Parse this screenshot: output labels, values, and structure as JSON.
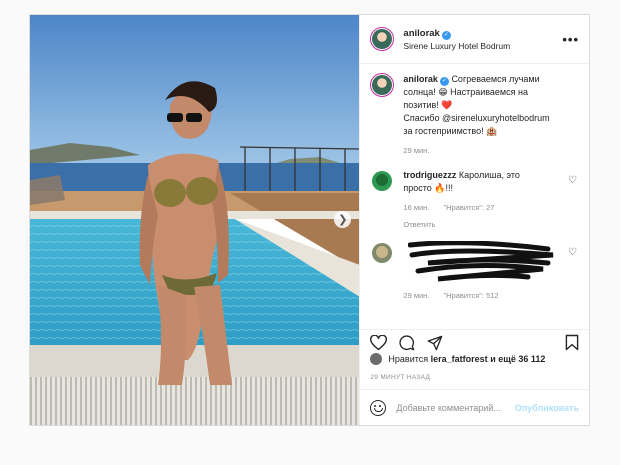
{
  "post": {
    "username": "anilorak",
    "location": "Sirene Luxury Hotel Bodrum",
    "more_label": "•••",
    "caption": {
      "line1": "Согреваемся лучами",
      "line2": "солнца! 😁 Настраиваемся на",
      "line3": "позитив! ❤️",
      "line4": "Спасибо @sireneluxuryhotelbodrum",
      "line5": "за гостеприимство! 🏨",
      "time": "29 мин."
    },
    "comments": [
      {
        "username": "trodriguezzz",
        "text": "Каролиша, это",
        "text2": "просто 🔥!!!",
        "time": "16 мин.",
        "likes": "\"Нравится\": 27",
        "replies": "Ответить"
      },
      {
        "username": "",
        "text": "",
        "time": "29 мин.",
        "likes": "\"Нравится\": 512"
      }
    ],
    "liked_by_prefix": "Нравится",
    "liked_by_user": "lera_fatforest",
    "liked_by_suffix": "и ещё 36 112",
    "timestamp": "29 МИНУТ НАЗАД",
    "add_comment_placeholder": "Добавьте комментарий...",
    "publish_label": "Опубликовать"
  },
  "colors": {
    "verified": "#3897f0",
    "publish": "#b2dffc",
    "meta": "#8e8e8e"
  }
}
